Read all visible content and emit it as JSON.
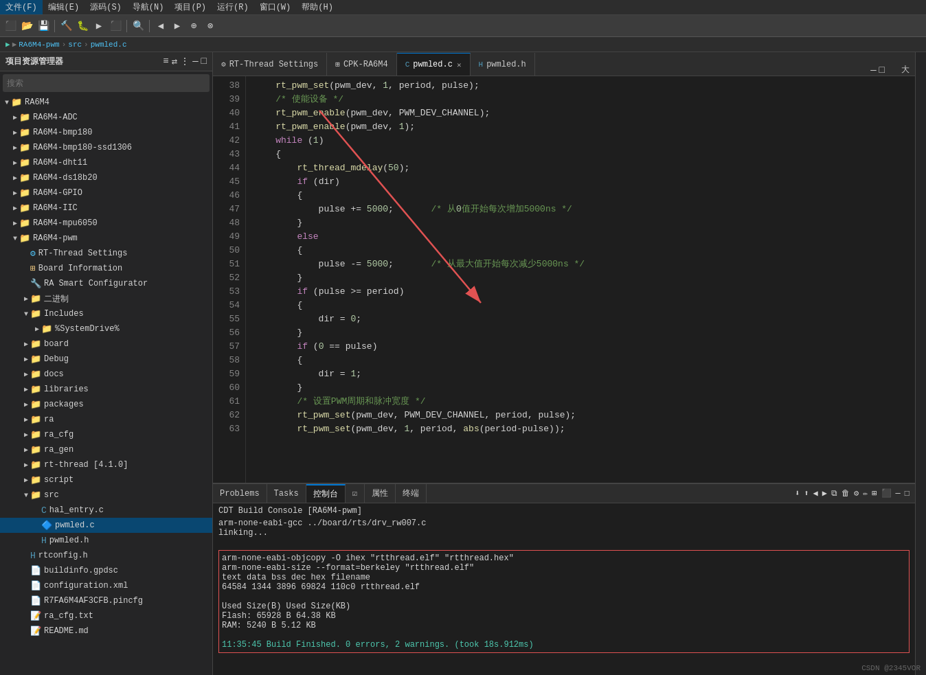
{
  "menuBar": {
    "items": [
      "文件(F)",
      "编辑(E)",
      "源码(S)",
      "导航(N)",
      "项目(P)",
      "运行(R)",
      "窗口(W)",
      "帮助(H)"
    ]
  },
  "breadcrumb": {
    "parts": [
      "RA6M4-pwm",
      "src",
      "pwmled.c"
    ]
  },
  "sidebar": {
    "title": "项目资源管理器",
    "searchPlaceholder": "搜索",
    "items": [
      {
        "label": "RA6M4",
        "level": 0,
        "type": "folder",
        "expanded": true
      },
      {
        "label": "RA6M4-ADC",
        "level": 1,
        "type": "folder",
        "expanded": false
      },
      {
        "label": "RA6M4-bmp180",
        "level": 1,
        "type": "folder",
        "expanded": false
      },
      {
        "label": "RA6M4-bmp180-ssd1306",
        "level": 1,
        "type": "folder",
        "expanded": false
      },
      {
        "label": "RA6M4-dht11",
        "level": 1,
        "type": "folder",
        "expanded": false
      },
      {
        "label": "RA6M4-ds18b20",
        "level": 1,
        "type": "folder",
        "expanded": false
      },
      {
        "label": "RA6M4-GPIO",
        "level": 1,
        "type": "folder",
        "expanded": false
      },
      {
        "label": "RA6M4-IIC",
        "level": 1,
        "type": "folder",
        "expanded": false
      },
      {
        "label": "RA6M4-mpu6050",
        "level": 1,
        "type": "folder",
        "expanded": false
      },
      {
        "label": "RA6M4-pwm",
        "level": 1,
        "type": "folder",
        "expanded": true
      },
      {
        "label": "RT-Thread Settings",
        "level": 2,
        "type": "settings",
        "expanded": false
      },
      {
        "label": "Board Information",
        "level": 2,
        "type": "board",
        "expanded": false
      },
      {
        "label": "RA Smart Configurator",
        "level": 2,
        "type": "ra",
        "expanded": false
      },
      {
        "label": "二进制",
        "level": 2,
        "type": "folder",
        "expanded": false
      },
      {
        "label": "Includes",
        "level": 2,
        "type": "includes",
        "expanded": false
      },
      {
        "label": "%SystemDrive%",
        "level": 3,
        "type": "folder",
        "expanded": false
      },
      {
        "label": "board",
        "level": 2,
        "type": "folder",
        "expanded": false
      },
      {
        "label": "Debug",
        "level": 2,
        "type": "folder",
        "expanded": false
      },
      {
        "label": "docs",
        "level": 2,
        "type": "folder",
        "expanded": false
      },
      {
        "label": "libraries",
        "level": 2,
        "type": "folder",
        "expanded": false
      },
      {
        "label": "packages",
        "level": 2,
        "type": "folder",
        "expanded": false
      },
      {
        "label": "ra",
        "level": 2,
        "type": "folder",
        "expanded": false
      },
      {
        "label": "ra_cfg",
        "level": 2,
        "type": "folder",
        "expanded": false
      },
      {
        "label": "ra_gen",
        "level": 2,
        "type": "folder",
        "expanded": false
      },
      {
        "label": "rt-thread [4.1.0]",
        "level": 2,
        "type": "folder",
        "expanded": false
      },
      {
        "label": "script",
        "level": 2,
        "type": "folder",
        "expanded": false
      },
      {
        "label": "src",
        "level": 2,
        "type": "folder",
        "expanded": true
      },
      {
        "label": "hal_entry.c",
        "level": 3,
        "type": "c",
        "expanded": false
      },
      {
        "label": "pwmled.c",
        "level": 3,
        "type": "c",
        "expanded": false,
        "selected": true
      },
      {
        "label": "pwmled.h",
        "level": 3,
        "type": "h",
        "expanded": false
      },
      {
        "label": "rtconfig.h",
        "level": 2,
        "type": "h",
        "expanded": false
      },
      {
        "label": "buildinfo.gpdsc",
        "level": 2,
        "type": "xml",
        "expanded": false
      },
      {
        "label": "configuration.xml",
        "level": 2,
        "type": "xml",
        "expanded": false
      },
      {
        "label": "R7FA6M4AF3CFB.pincfg",
        "level": 2,
        "type": "cfg",
        "expanded": false
      },
      {
        "label": "ra_cfg.txt",
        "level": 2,
        "type": "txt",
        "expanded": false
      },
      {
        "label": "README.md",
        "level": 2,
        "type": "md",
        "expanded": false
      }
    ]
  },
  "tabs": [
    {
      "label": "RT-Thread Settings",
      "active": false,
      "icon": "⚙"
    },
    {
      "label": "CPK-RA6M4",
      "active": false,
      "icon": "⊞"
    },
    {
      "label": "pwmled.c",
      "active": true,
      "icon": "C",
      "modified": false
    },
    {
      "label": "pwmled.h",
      "active": false,
      "icon": "H"
    }
  ],
  "codeLines": [
    {
      "num": 38,
      "text": "    rt_pwm_set(pwm_dev, 1, period, pulse);"
    },
    {
      "num": 39,
      "text": "    /* 使能设备 */"
    },
    {
      "num": 40,
      "text": "    rt_pwm_enable(pwm_dev, PWM_DEV_CHANNEL);"
    },
    {
      "num": 41,
      "text": "    rt_pwm_enable(pwm_dev, 1);"
    },
    {
      "num": 42,
      "text": "    while (1)"
    },
    {
      "num": 43,
      "text": "    {"
    },
    {
      "num": 44,
      "text": "        rt_thread_mdelay(50);"
    },
    {
      "num": 45,
      "text": "        if (dir)"
    },
    {
      "num": 46,
      "text": "        {"
    },
    {
      "num": 47,
      "text": "            pulse += 5000;       /* 从0值开始每次增加5000ns */"
    },
    {
      "num": 48,
      "text": "        }"
    },
    {
      "num": 49,
      "text": "        else"
    },
    {
      "num": 50,
      "text": "        {"
    },
    {
      "num": 51,
      "text": "            pulse -= 5000;       /* 从最大值开始每次减少5000ns */"
    },
    {
      "num": 52,
      "text": "        }"
    },
    {
      "num": 53,
      "text": "        if (pulse >= period)"
    },
    {
      "num": 54,
      "text": "        {"
    },
    {
      "num": 55,
      "text": "            dir = 0;"
    },
    {
      "num": 56,
      "text": "        }"
    },
    {
      "num": 57,
      "text": "        if (0 == pulse)"
    },
    {
      "num": 58,
      "text": "        {"
    },
    {
      "num": 59,
      "text": "            dir = 1;"
    },
    {
      "num": 60,
      "text": "        }"
    },
    {
      "num": 61,
      "text": "        /* 设置PWM周期和脉冲宽度 */"
    },
    {
      "num": 62,
      "text": "        rt_pwm_set(pwm_dev, PWM_DEV_CHANNEL, period, pulse);"
    },
    {
      "num": 63,
      "text": "        rt_pwm_set(pwm_dev, 1, period, abs(period-pulse));"
    }
  ],
  "bottomTabs": [
    {
      "label": "Problems",
      "active": false
    },
    {
      "label": "Tasks",
      "active": false
    },
    {
      "label": "控制台",
      "active": true
    },
    {
      "label": "☑",
      "active": false
    },
    {
      "label": "属性",
      "active": false
    },
    {
      "label": "终端",
      "active": false
    }
  ],
  "console": {
    "title": "CDT Build Console [RA6M4-pwm]",
    "lines": [
      "arm-none-eabi-gcc ../board/rts/drv_rw007.c",
      "linking...",
      "",
      "arm-none-eabi-objcopy -O ihex \"rtthread.elf\" \"rtthread.hex\"",
      "arm-none-eabi-size --format=berkeley \"rtthread.elf\"",
      "   text    data     bss     dec     hex filename",
      "  64584    1344    3896   69824   110c0 rtthread.elf",
      "",
      "            Used Size(B)           Used Size(KB)",
      "Flash:         65928 B               64.38 KB",
      "RAM:            5240 B                5.12 KB",
      "",
      "11:35:45 Build Finished. 0 errors, 2 warnings. (took 18s.912ms)"
    ],
    "buildHighlightStart": 3,
    "buildHighlightEnd": 12
  },
  "watermark": "CSDN @2345VOR"
}
